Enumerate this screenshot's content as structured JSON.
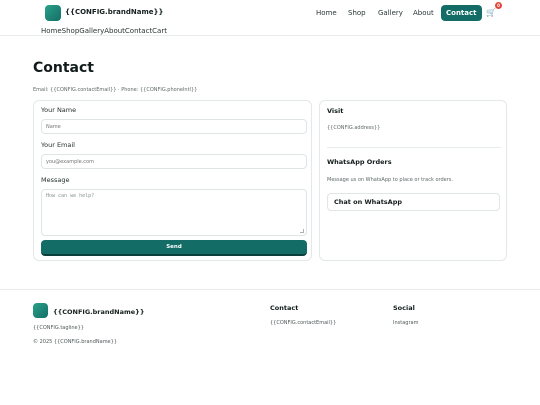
{
  "header": {
    "brand": "{{CONFIG.brandName}}",
    "nav": [
      "Home",
      "Shop",
      "Gallery",
      "About",
      "Contact"
    ],
    "active_nav": "Contact",
    "cart_count": "0"
  },
  "subnav": [
    "Home",
    "Shop",
    "Gallery",
    "About",
    "Contact",
    "Cart"
  ],
  "page": {
    "title": "Contact",
    "contact_line": "Email: {{CONFIG.contactEmail}} · Phone: {{CONFIG.phoneIntl}}"
  },
  "form": {
    "name_label": "Your Name",
    "name_placeholder": "Name",
    "email_label": "Your Email",
    "email_placeholder": "you@example.com",
    "message_label": "Message",
    "message_placeholder": "How can we help?",
    "send_label": "Send"
  },
  "sidebar": {
    "visit_heading": "Visit",
    "address": "{{CONFIG.address}}",
    "whatsapp_heading": "WhatsApp Orders",
    "whatsapp_text": "Message us on WhatsApp to place or track orders.",
    "whatsapp_button": "Chat on WhatsApp"
  },
  "footer": {
    "brand": "{{CONFIG.brandName}}",
    "tagline": "{{CONFIG.tagline}}",
    "copyright": "© 2025 {{CONFIG.brandName}}",
    "contact_heading": "Contact",
    "contact_email": "{{CONFIG.contactEmail}}",
    "social_heading": "Social",
    "social_link": "Instagram"
  },
  "colors": {
    "accent": "#136c66",
    "badge": "#e0473b"
  },
  "icons": {
    "cart": "cart-icon"
  }
}
